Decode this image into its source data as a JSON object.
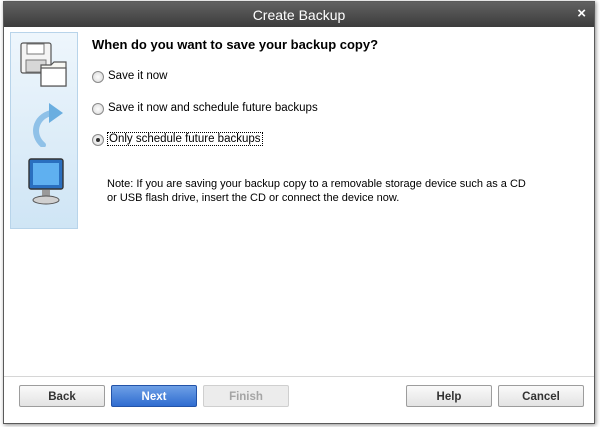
{
  "window": {
    "title": "Create Backup",
    "close_glyph": "×"
  },
  "sidebar": {
    "icons": [
      "floppy-folder-icon",
      "curved-arrow-icon",
      "monitor-icon"
    ],
    "accent": "#cfe5f5"
  },
  "content": {
    "heading": "When do you want to save your backup copy?",
    "options": [
      {
        "label": "Save it now",
        "selected": false
      },
      {
        "label": "Save it now and schedule future backups",
        "selected": false
      },
      {
        "label": "Only schedule future backups",
        "selected": true
      }
    ],
    "note": "Note: If you are saving your backup copy to a removable storage device such as a CD or USB flash drive, insert the CD or connect the device now."
  },
  "footer": {
    "back": "Back",
    "next": "Next",
    "finish": "Finish",
    "help": "Help",
    "cancel": "Cancel"
  },
  "colors": {
    "titlebar": "#4a4a4a",
    "primary_button": "#2f6cd0"
  }
}
